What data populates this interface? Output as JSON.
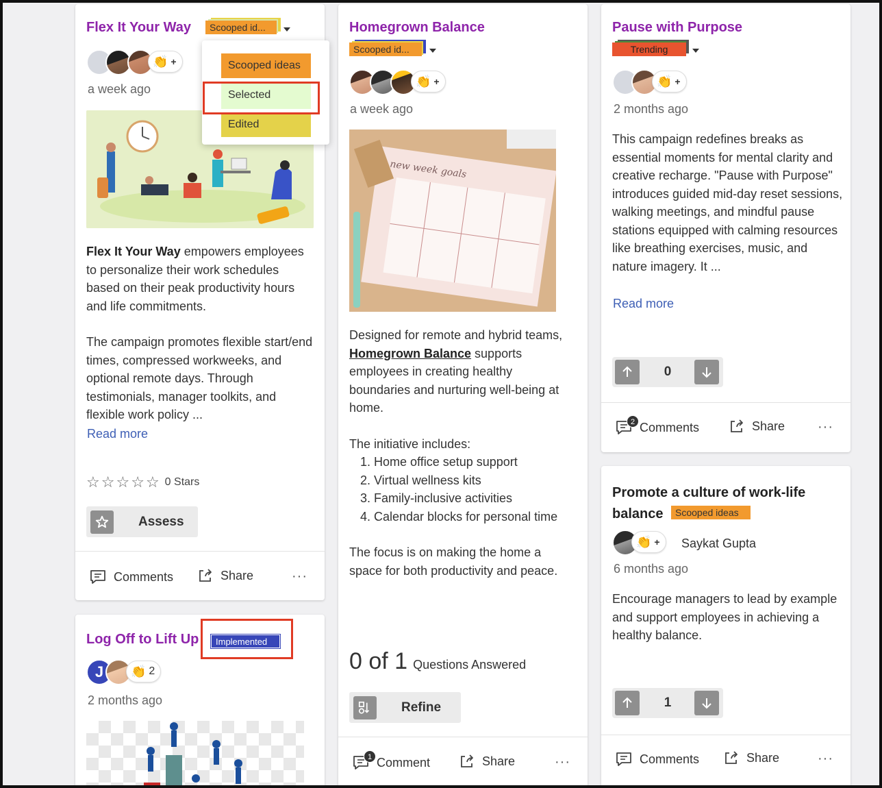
{
  "colors": {
    "title_purple": "#8e24aa",
    "tag_orange": "#f29a2e",
    "tag_red": "#e8542f",
    "tag_blue": "#3746b8",
    "link_blue": "#3e5fb5",
    "highlight_red": "#e03b24"
  },
  "card1": {
    "title": "Flex It Your Way",
    "tag": "Scooped id...",
    "reaction_icon": "clap-icon",
    "reaction_plus": "+",
    "time": "a week ago",
    "body_bold": "Flex It Your Way",
    "body_p1": " empowers employ­ees to personalize their work sched­ules based on their peak productivity hours and life commitments.",
    "body_p2": "The campaign promotes flexible start/end times, compressed work­weeks, and optional remote days. Through testimonials, manager tool­kits, and flexible work policy ...",
    "read_more": "Read more",
    "rating_stars": 0,
    "rating_label": "0 Stars",
    "assess_label": "Assess",
    "comments_label": "Comments",
    "share_label": "Share",
    "more": "···"
  },
  "dropdown": {
    "options": [
      "Scooped ideas",
      "Selected",
      "Edited"
    ]
  },
  "card2": {
    "title": "Log Off to Lift Up",
    "tag": "Implemented",
    "avatar_initial": "J",
    "reaction_count": "2",
    "time": "2 months ago"
  },
  "card3": {
    "title": "Homegrown Balance",
    "tag": "Scooped id...",
    "reaction_plus": "+",
    "time": "a week ago",
    "body_p1_a": "Designed for remote and hybrid teams, ",
    "body_p1_link": "Homegrown Balance",
    "body_p1_b": " sup­ports employees in creating healthy boundaries and nurturing well-being at home.",
    "body_p2": "The initiative includes:",
    "list": [
      "Home office setup support",
      "Virtual wellness kits",
      "Family-inclusive activities",
      "Calendar blocks for personal time"
    ],
    "body_p3": "The focus is on making the home a space for both productivity and peace.",
    "qa_count": "0 of 1",
    "qa_label": "Questions Answered",
    "refine_label": "Refine",
    "comment_badge": "1",
    "comment_label": "Comment",
    "share_label": "Share",
    "more": "···"
  },
  "card4": {
    "title": "Pause with Purpose",
    "tag": "Trending",
    "reaction_plus": "+",
    "time": "2 months ago",
    "body": "This campaign redefines breaks as essential moments for mental clarity and creative recharge. \"Pause with Purpose\" introduces guided mid-day reset sessions, walking meetings, and mindful pause stations equipped with calming resources like breathing exercises, music, and nature imagery. It ...",
    "read_more": "Read more",
    "votes": "0",
    "comment_badge": "2",
    "comments_label": "Comments",
    "share_label": "Share",
    "more": "···"
  },
  "card5": {
    "title_line1": "Promote a culture of work-life",
    "title_line2": "balance",
    "tag": "Scooped ideas",
    "reaction_plus": "+",
    "author": "Saykat Gupta",
    "time": "6 months ago",
    "body": "Encourage managers to lead by ex­ample and support employees in achieving a healthy balance.",
    "votes": "1",
    "comments_label": "Comments",
    "share_label": "Share",
    "more": "···"
  }
}
